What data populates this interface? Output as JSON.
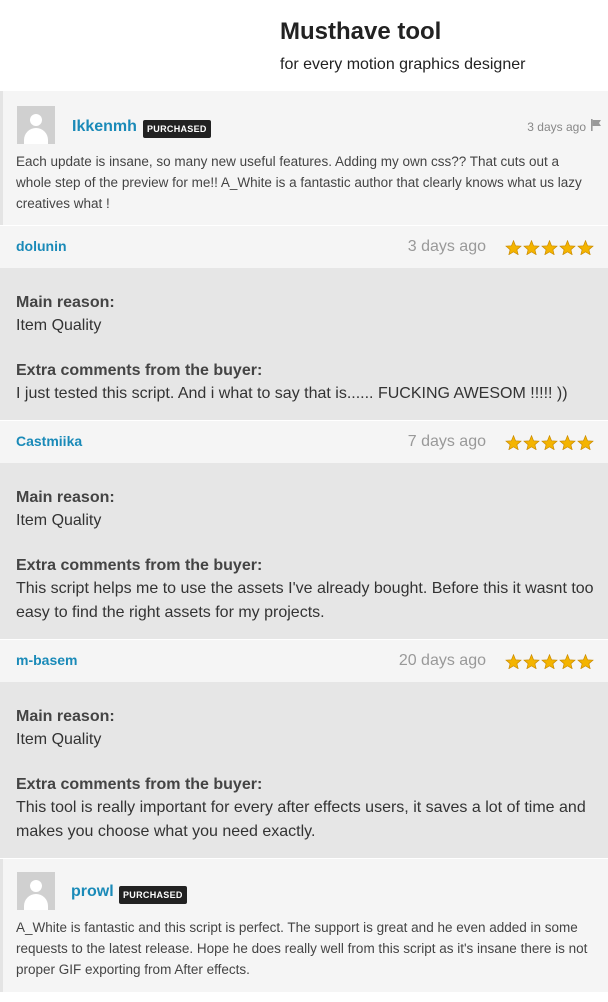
{
  "header": {
    "title": "Musthave tool",
    "subtitle": "for every motion graphics designer"
  },
  "comments": [
    {
      "author": "Ikkenmh",
      "badge": "PURCHASED",
      "date": "3 days ago",
      "text": "Each update is insane, so many new useful features. Adding my own css?? That cuts out a whole step of the preview for me!! A_White is a fantastic author that clearly knows what us lazy creatives what !"
    },
    {
      "author": "prowl",
      "badge": "PURCHASED",
      "text": "A_White is fantastic and this script is perfect. The support is great and he even added in some requests to the latest release. Hope he does really well from this script as it's insane there is not proper GIF exporting from After effects."
    }
  ],
  "reviews": [
    {
      "user": "dolunin",
      "date": "3 days ago",
      "rating": 5,
      "reason_label": "Main reason:",
      "reason": "Item Quality",
      "extra_label": "Extra comments from the buyer:",
      "extra": "I just tested this script. And i what to say that is...... FUCKING AWESOM !!!!! ))"
    },
    {
      "user": "Castmiika",
      "date": "7 days ago",
      "rating": 5,
      "reason_label": "Main reason:",
      "reason": "Item Quality",
      "extra_label": "Extra comments from the buyer:",
      "extra": "This script helps me to use the assets I've already bought. Before this it wasnt too easy to find the right assets for my projects."
    },
    {
      "user": "m-basem",
      "date": "20 days ago",
      "rating": 5,
      "reason_label": "Main reason:",
      "reason": "Item Quality",
      "extra_label": "Extra comments from the buyer:",
      "extra": "This tool is really important for every after effects users, it saves a lot of time and makes you choose what you need exactly."
    }
  ],
  "colors": {
    "link": "#1a8ab8",
    "badge_bg": "#222222",
    "star": "#f4b400",
    "review_body_bg": "#e6e6e6"
  },
  "icons": {
    "avatar": "avatar-placeholder-icon",
    "flag": "flag-icon",
    "star": "star-icon"
  }
}
